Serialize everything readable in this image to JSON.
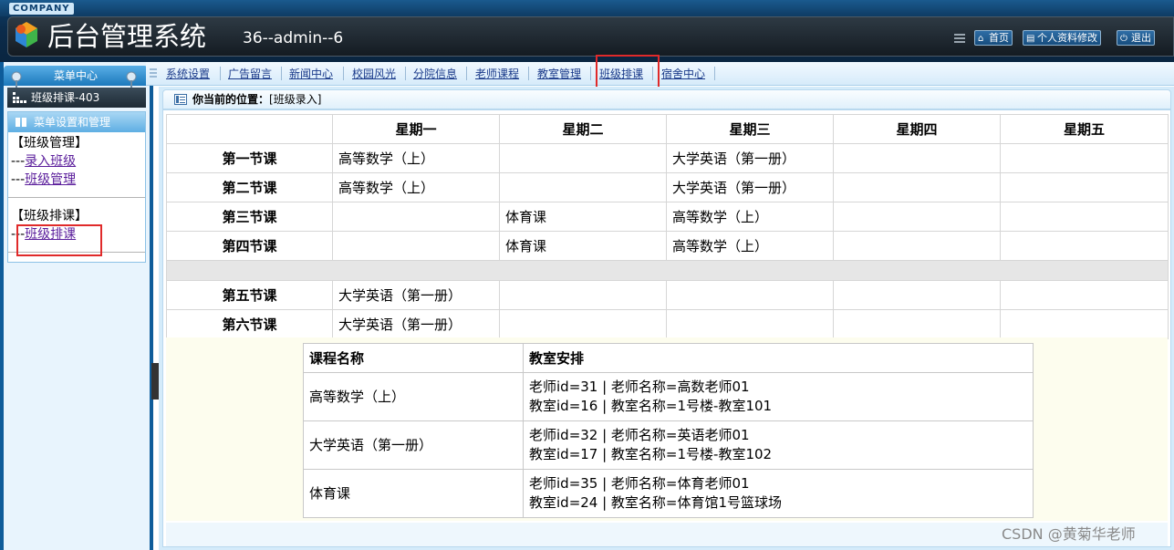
{
  "header": {
    "company": "COMPANY",
    "title": "后台管理系统",
    "user_info": "36--admin--6",
    "buttons": [
      {
        "label": "首页",
        "icon": "home-icon"
      },
      {
        "label": "个人资料修改",
        "icon": "document-icon"
      },
      {
        "label": "退出",
        "icon": "power-icon"
      }
    ]
  },
  "nav": {
    "items": [
      "系统设置",
      "广告留言",
      "新闻中心",
      "校园风光",
      "分院信息",
      "老师课程",
      "教室管理",
      "班级排课",
      "宿舍中心"
    ],
    "active": "班级排课"
  },
  "sidebar": {
    "menu_center": "菜单中心",
    "current_page": "班级排课-403",
    "panel_title": "菜单设置和管理",
    "groups": [
      {
        "title": "【班级管理】",
        "links": [
          {
            "prefix": "---",
            "label": "录入班级"
          },
          {
            "prefix": "---",
            "label": "班级管理"
          }
        ]
      },
      {
        "title": "【班级排课】",
        "links": [
          {
            "prefix": "---",
            "label": "班级排课"
          }
        ]
      }
    ]
  },
  "breadcrumb": {
    "label": "你当前的位置：",
    "value": "[班级录入]"
  },
  "schedule": {
    "days": [
      "星期一",
      "星期二",
      "星期三",
      "星期四",
      "星期五"
    ],
    "rows": [
      {
        "period": "第一节课",
        "cells": [
          "高等数学（上）",
          "",
          "大学英语（第一册）",
          "",
          ""
        ]
      },
      {
        "period": "第二节课",
        "cells": [
          "高等数学（上）",
          "",
          "大学英语（第一册）",
          "",
          ""
        ]
      },
      {
        "period": "第三节课",
        "cells": [
          "",
          "体育课",
          "高等数学（上）",
          "",
          ""
        ]
      },
      {
        "period": "第四节课",
        "cells": [
          "",
          "体育课",
          "高等数学（上）",
          "",
          ""
        ]
      },
      {
        "period": "第五节课",
        "cells": [
          "大学英语（第一册）",
          "",
          "",
          "",
          ""
        ]
      },
      {
        "period": "第六节课",
        "cells": [
          "大学英语（第一册）",
          "",
          "",
          "",
          ""
        ]
      }
    ]
  },
  "course_info": {
    "headers": [
      "课程名称",
      "教室安排"
    ],
    "rows": [
      {
        "name": "高等数学（上）",
        "teacher": "老师id=31 | 老师名称=高数老师01",
        "room": "教室id=16 | 教室名称=1号楼-教室101"
      },
      {
        "name": "大学英语（第一册）",
        "teacher": "老师id=32 | 老师名称=英语老师01",
        "room": "教室id=17 | 教室名称=1号楼-教室102"
      },
      {
        "name": "体育课",
        "teacher": "老师id=35 | 老师名称=体育老师01",
        "room": "教室id=24 | 教室名称=体育馆1号篮球场"
      }
    ]
  },
  "watermark": "CSDN @黄菊华老师",
  "colors": {
    "highlight": "#e02a2a",
    "link": "#5a1d9b",
    "header_bg": "#0f3f6a"
  }
}
